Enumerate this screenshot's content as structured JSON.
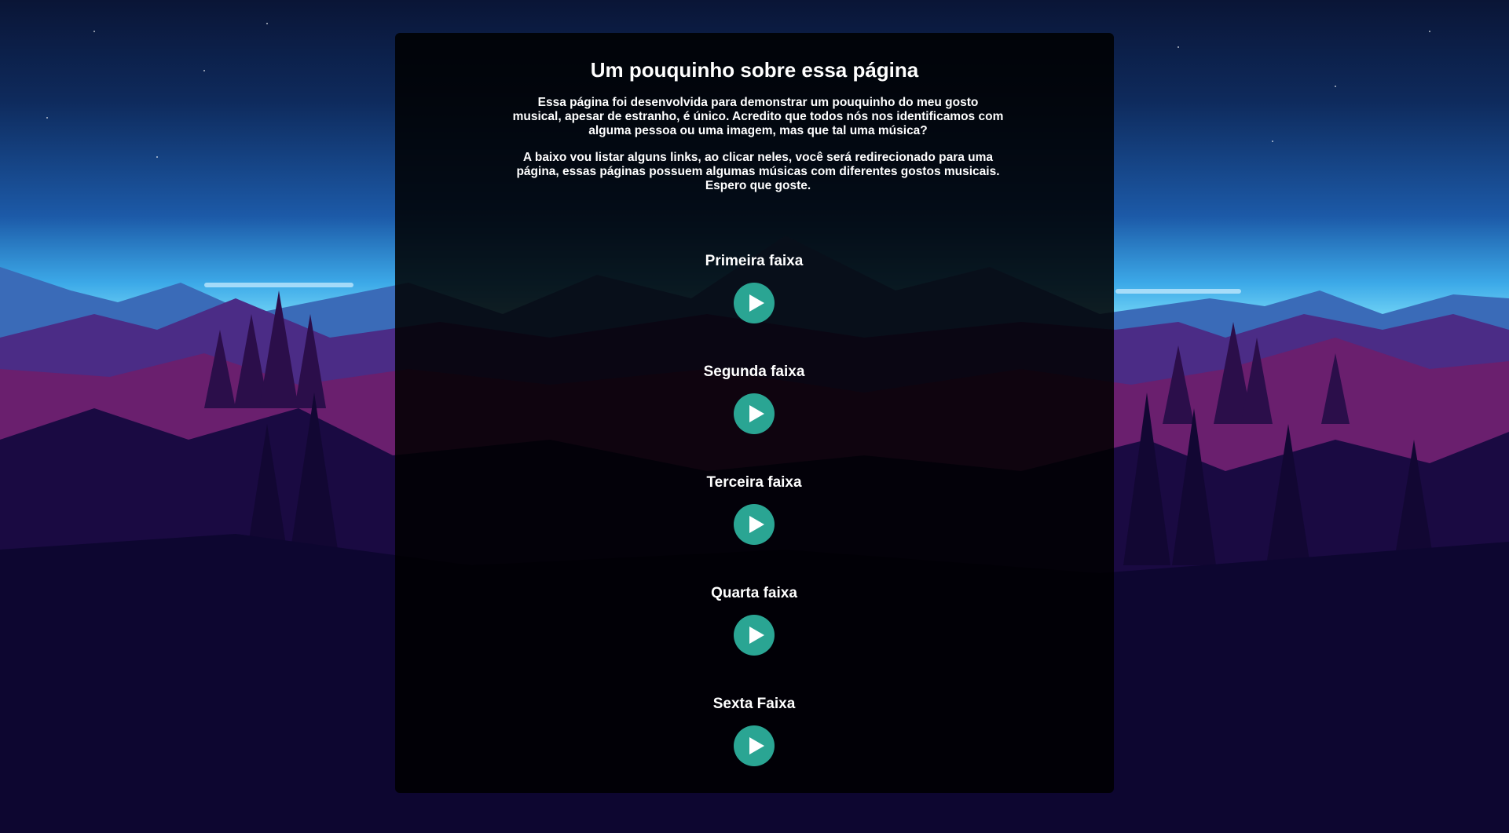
{
  "header": {
    "title": "Um pouquinho sobre essa página"
  },
  "intro": {
    "paragraph1": "Essa página foi desenvolvida para demonstrar um pouquinho do meu gosto musical, apesar de estranho, é único. Acredito que todos nós nos identificamos com alguma pessoa ou uma imagem, mas que tal uma música?",
    "paragraph2": "A baixo vou listar alguns links, ao clicar neles, você será redirecionado para uma página, essas páginas possuem algumas músicas com diferentes gostos musicais. Espero que goste."
  },
  "tracks": [
    {
      "title": "Primeira faixa",
      "icon": "play-icon"
    },
    {
      "title": "Segunda faixa",
      "icon": "play-icon"
    },
    {
      "title": "Terceira faixa",
      "icon": "play-icon"
    },
    {
      "title": "Quarta faixa",
      "icon": "play-icon"
    },
    {
      "title": "Sexta Faixa",
      "icon": "play-icon"
    }
  ],
  "colors": {
    "accent": "#2aa593",
    "panel": "#000000",
    "text": "#ffffff"
  }
}
